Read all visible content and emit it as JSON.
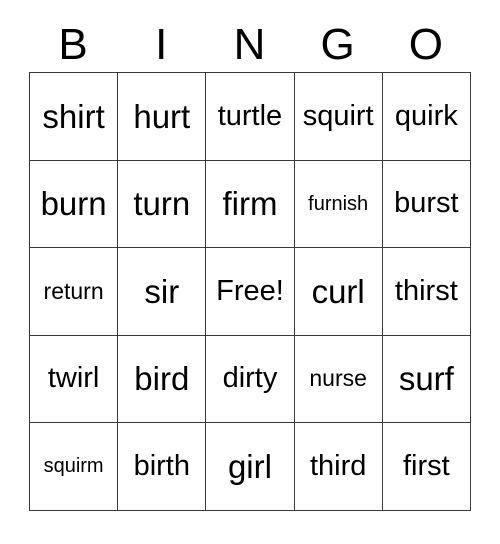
{
  "card": {
    "title": "BINGO",
    "header_letters": [
      "B",
      "I",
      "N",
      "G",
      "O"
    ],
    "columns": 5,
    "rows": 5,
    "free_space_label": "Free!",
    "free_space_position": {
      "row": 3,
      "column": 3
    },
    "border_color": "#3a3a3a",
    "text_color": "#000000",
    "background_color": "#ffffff",
    "cells": [
      [
        {
          "text": "shirt",
          "size": "lg"
        },
        {
          "text": "hurt",
          "size": "lg"
        },
        {
          "text": "turtle",
          "size": "md"
        },
        {
          "text": "squirt",
          "size": "md"
        },
        {
          "text": "quirk",
          "size": "md"
        }
      ],
      [
        {
          "text": "burn",
          "size": "lg"
        },
        {
          "text": "turn",
          "size": "lg"
        },
        {
          "text": "firm",
          "size": "lg"
        },
        {
          "text": "furnish",
          "size": "xs"
        },
        {
          "text": "burst",
          "size": "md"
        }
      ],
      [
        {
          "text": "return",
          "size": "sm"
        },
        {
          "text": "sir",
          "size": "lg"
        },
        {
          "text": "Free!",
          "size": "md"
        },
        {
          "text": "curl",
          "size": "lg"
        },
        {
          "text": "thirst",
          "size": "md"
        }
      ],
      [
        {
          "text": "twirl",
          "size": "md"
        },
        {
          "text": "bird",
          "size": "lg"
        },
        {
          "text": "dirty",
          "size": "md"
        },
        {
          "text": "nurse",
          "size": "sm"
        },
        {
          "text": "surf",
          "size": "lg"
        }
      ],
      [
        {
          "text": "squirm",
          "size": "xs"
        },
        {
          "text": "birth",
          "size": "md"
        },
        {
          "text": "girl",
          "size": "lg"
        },
        {
          "text": "third",
          "size": "md"
        },
        {
          "text": "first",
          "size": "md"
        }
      ]
    ]
  }
}
